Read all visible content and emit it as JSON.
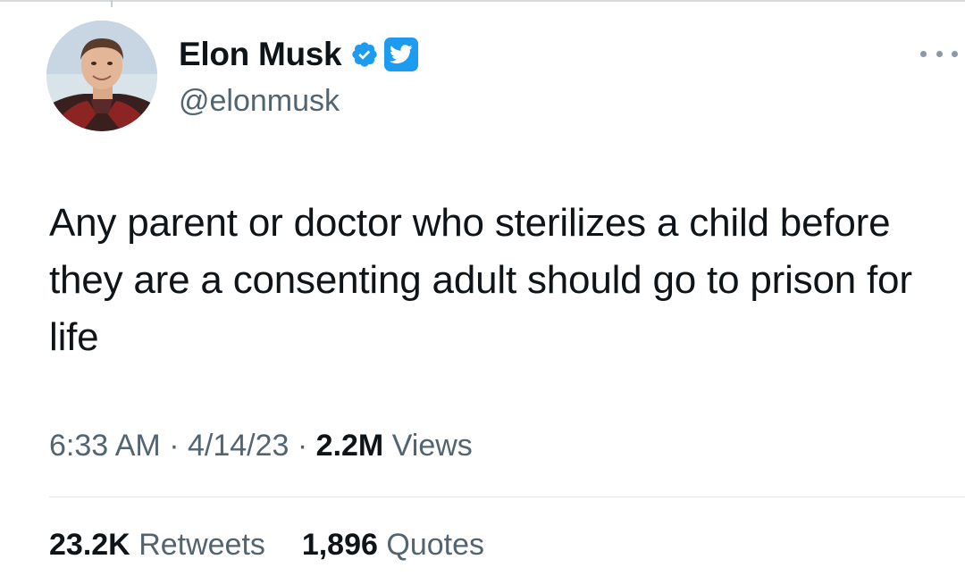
{
  "tweet": {
    "author": {
      "display_name": "Elon Musk",
      "handle": "@elonmusk",
      "verified_icon": "verified-badge-icon",
      "platform_icon": "twitter-bird-icon"
    },
    "menu_icon": "more-options-icon",
    "text": "Any parent or doctor who sterilizes a child before they are a consenting adult should go to prison for life",
    "meta": {
      "time": "6:33 AM",
      "separator": "·",
      "date": "4/14/23",
      "views_count": "2.2M",
      "views_label": "Views"
    },
    "stats": {
      "retweets_count": "23.2K",
      "retweets_label": "Retweets",
      "quotes_count": "1,896",
      "quotes_label": "Quotes"
    }
  },
  "colors": {
    "primary_text": "#0f1419",
    "secondary_text": "#536471",
    "accent_blue": "#1d9bf0",
    "divider": "#e1e5e8"
  }
}
